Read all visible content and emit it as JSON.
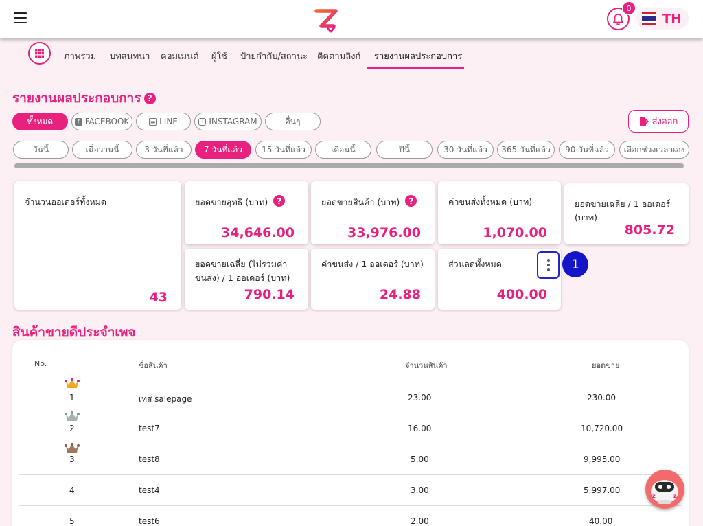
{
  "header": {
    "notifications": "0",
    "language": "TH"
  },
  "nav": {
    "tabs": [
      "ภาพรวม",
      "บทสนทนา",
      "คอมเมนต์",
      "ผู้ใช้",
      "ป้ายกำกับ/สถานะ",
      "ติดตามลิงก์",
      "รายงานผลประกอบการ"
    ],
    "active": "รายงานผลประกอบการ"
  },
  "report": {
    "title": "รายงานผลประกอบการ",
    "channels": [
      "ทั้งหมด",
      "FACEBOOK",
      "LINE",
      "INSTAGRAM",
      "อื่นๆ"
    ],
    "export_label": "ส่งออก",
    "ranges": [
      "วันนี้",
      "เมื่อวานนี้",
      "3 วันที่แล้ว",
      "7 วันที่แล้ว",
      "15 วันที่แล้ว",
      "เดือนนี้",
      "ปีนี้",
      "30 วันที่แล้ว",
      "365 วันที่แล้ว",
      "90 วันที่แล้ว",
      "เลือกช่วงเวลาเอง"
    ]
  },
  "cards": {
    "total_orders": {
      "label": "จำนวนออเดอร์ทั้งหมด",
      "value": "43"
    },
    "net_sales": {
      "label": "ยอดขายสุทธิ (บาท)",
      "value": "34,646.00"
    },
    "product_sales": {
      "label": "ยอดขายสินค้า (บาท)",
      "value": "33,976.00"
    },
    "total_shipping": {
      "label": "ค่าขนส่งทั้งหมด (บาท)",
      "value": "1,070.00"
    },
    "avg_per_order": {
      "label": "ยอดขายเฉลี่ย / 1 ออเดอร์ (บาท)",
      "value": "805.72"
    },
    "avg_excl_shipping": {
      "label": "ยอดขายเฉลี่ย (ไม่รวมค่าขนส่ง) / 1 ออเดอร์ (บาท)",
      "value": "790.14"
    },
    "shipping_per_order": {
      "label": "ค่าขนส่ง / 1 ออเดอร์ (บาท)",
      "value": "24.88"
    },
    "total_discount": {
      "label": "ส่วนลดทั้งหมด",
      "value": "400.00"
    }
  },
  "annotation": {
    "step": "1"
  },
  "bestsellers": {
    "title": "สินค้าขายดีประจำเพจ",
    "columns": [
      "No.",
      "ชื่อสินค้า",
      "จำนวนสินค้า",
      "ยอดขาย"
    ],
    "rows": [
      {
        "no": "1",
        "name": "เทส salepage",
        "qty": "23.00",
        "sales": "230.00"
      },
      {
        "no": "2",
        "name": "test7",
        "qty": "16.00",
        "sales": "10,720.00"
      },
      {
        "no": "3",
        "name": "test8",
        "qty": "5.00",
        "sales": "9,995.00"
      },
      {
        "no": "4",
        "name": "test4",
        "qty": "3.00",
        "sales": "5,997.00"
      },
      {
        "no": "5",
        "name": "test6",
        "qty": "2.00",
        "sales": "40.00"
      }
    ]
  },
  "colors": {
    "accent": "#e8207e",
    "annotation": "#1414c8"
  }
}
